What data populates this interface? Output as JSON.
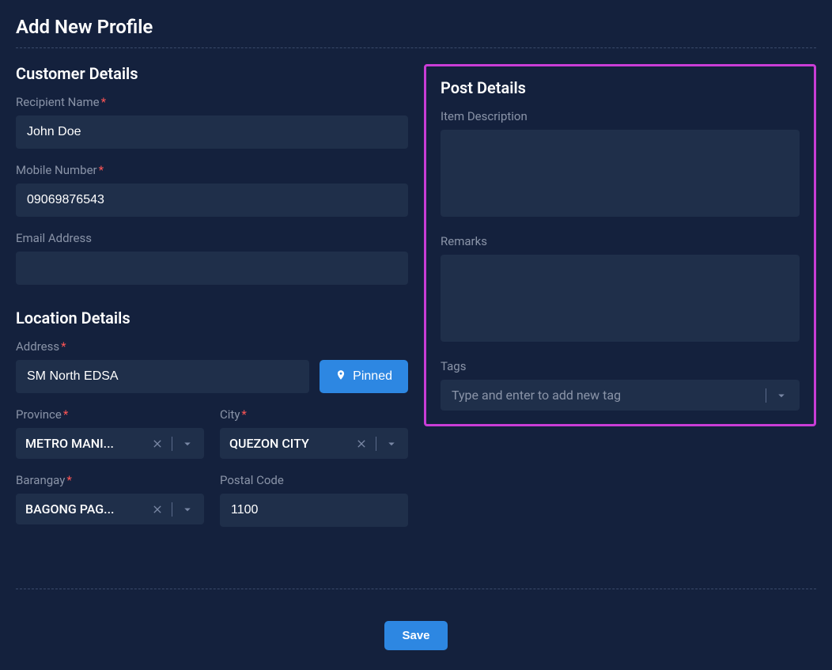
{
  "page": {
    "title": "Add New Profile"
  },
  "customer": {
    "section_title": "Customer Details",
    "recipient_name": {
      "label": "Recipient Name",
      "value": "John Doe"
    },
    "mobile_number": {
      "label": "Mobile Number",
      "value": "09069876543"
    },
    "email_address": {
      "label": "Email Address",
      "value": ""
    }
  },
  "location": {
    "section_title": "Location Details",
    "address": {
      "label": "Address",
      "value": "SM North EDSA"
    },
    "pinned_label": "Pinned",
    "province": {
      "label": "Province",
      "value": "METRO MANI..."
    },
    "city": {
      "label": "City",
      "value": "QUEZON CITY"
    },
    "barangay": {
      "label": "Barangay",
      "value": "BAGONG PAG..."
    },
    "postal_code": {
      "label": "Postal Code",
      "value": "1100"
    }
  },
  "post": {
    "section_title": "Post Details",
    "item_description": {
      "label": "Item Description",
      "value": ""
    },
    "remarks": {
      "label": "Remarks",
      "value": ""
    },
    "tags": {
      "label": "Tags",
      "placeholder": "Type and enter to add new tag"
    }
  },
  "actions": {
    "save_label": "Save"
  }
}
